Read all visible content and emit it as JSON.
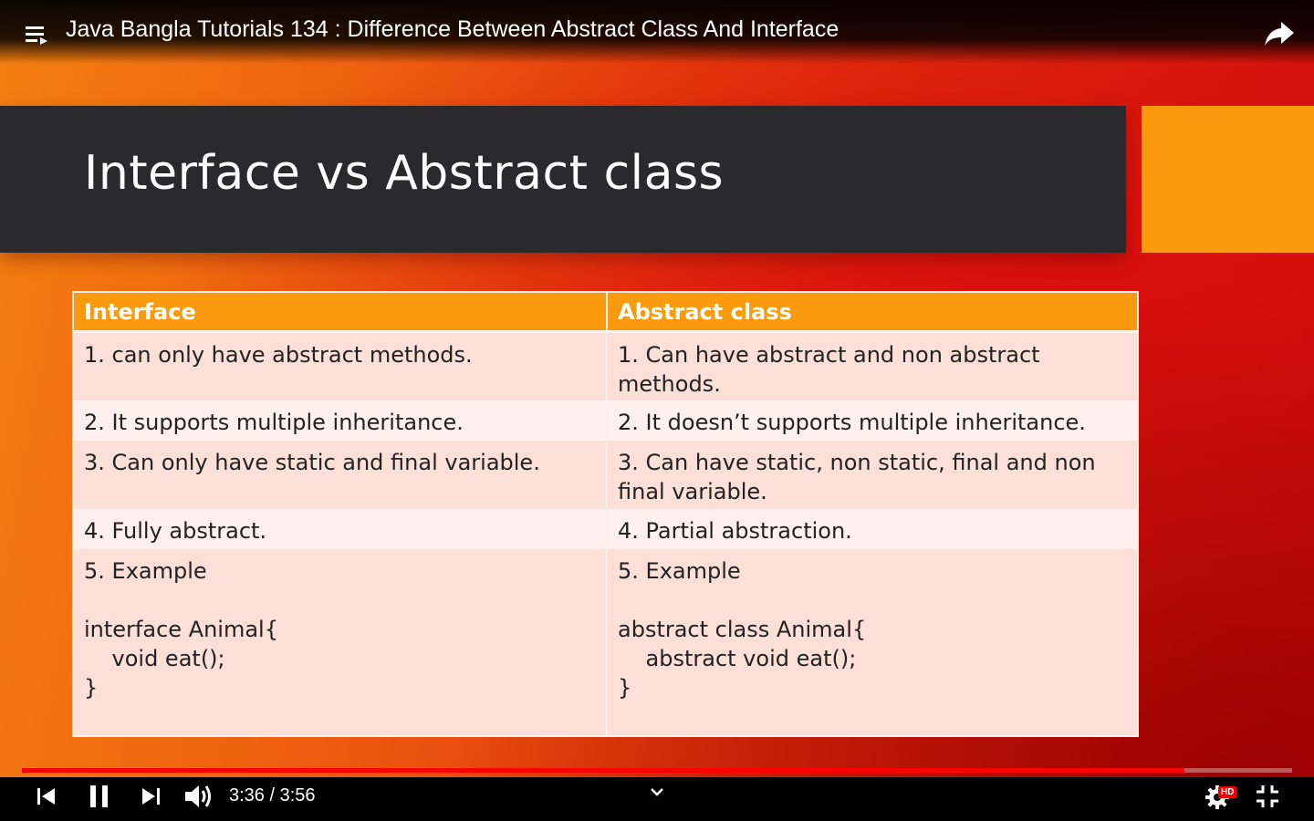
{
  "player": {
    "title": "Java Bangla Tutorials 134 : Difference Between Abstract Class And Interface",
    "current_time": "3:36",
    "duration": "3:56",
    "time_display": "3:36 / 3:56",
    "progress_fraction": 0.915,
    "hd_label": "HD",
    "icons": {
      "playlist": "playlist-icon",
      "share": "share-icon",
      "previous": "skip-previous-icon",
      "pause": "pause-icon",
      "next": "skip-next-icon",
      "volume": "volume-icon",
      "chevron": "chevron-down-icon",
      "settings": "gear-icon",
      "exit_fullscreen": "exit-fullscreen-icon"
    },
    "colors": {
      "progress": "#ff0000",
      "accent_orange": "#fb9a0d",
      "banner": "#2a292b"
    }
  },
  "slide": {
    "title": "Interface vs Abstract class",
    "table": {
      "headers": [
        "Interface",
        "Abstract class"
      ],
      "rows": [
        [
          "1. can only have abstract methods.",
          "1. Can have abstract and non abstract\nmethods."
        ],
        [
          "2. It supports multiple inheritance.",
          "2. It doesn’t supports multiple inheritance."
        ],
        [
          "3. Can only have static and final variable.",
          "3. Can have static, non static, final and non\nfinal variable."
        ],
        [
          "4. Fully abstract.",
          "4. Partial abstraction."
        ],
        [
          "5. Example\n\ninterface Animal{\n    void eat();\n}",
          "5. Example\n\nabstract class Animal{\n    abstract void eat();\n}"
        ]
      ]
    }
  }
}
